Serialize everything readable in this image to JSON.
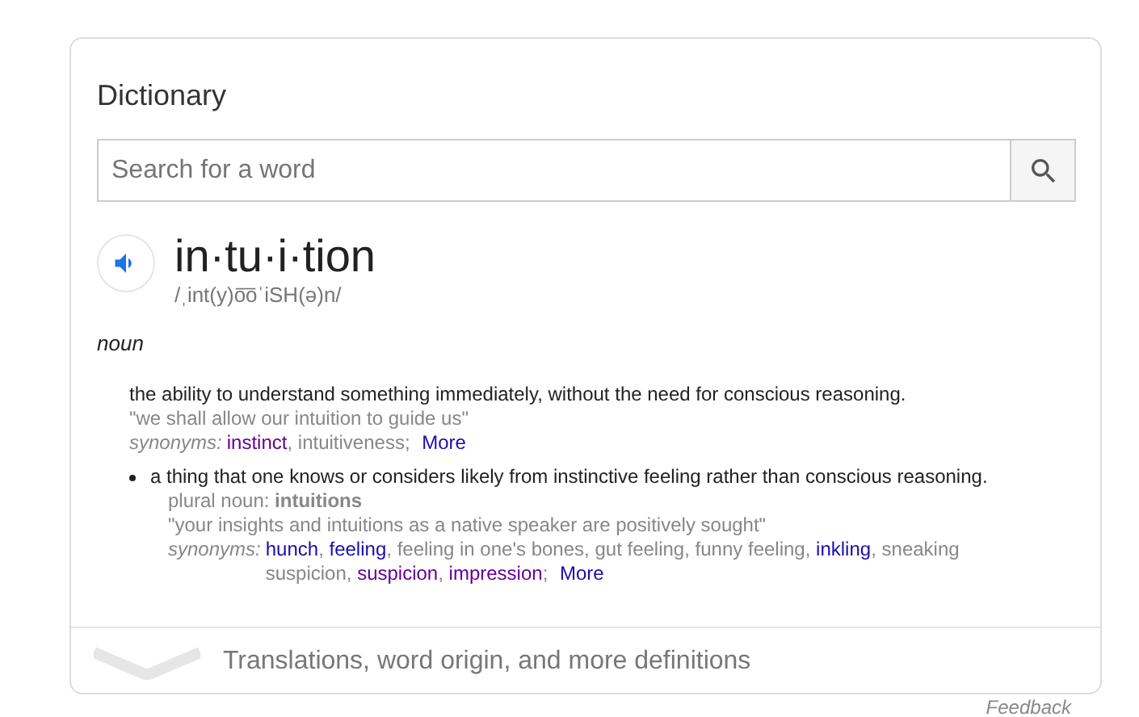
{
  "card": {
    "title": "Dictionary",
    "search": {
      "placeholder": "Search for a word"
    },
    "word": "in·tu·i·tion",
    "pronunciation": "/ˌint(y)o͞oˈiSH(ə)n/",
    "part_of_speech": "noun",
    "senses": [
      {
        "bullet": false,
        "definition": "the ability to understand something immediately, without the need for conscious reasoning.",
        "example": "\"we shall allow our intuition to guide us\"",
        "synonyms_label": "synonyms:",
        "synonyms": [
          {
            "text": "instinct",
            "kind": "visited",
            "separator": ","
          },
          {
            "text": "intuitiveness",
            "kind": "plain",
            "separator": ";"
          }
        ],
        "more": "More"
      },
      {
        "bullet": true,
        "definition": "a thing that one knows or considers likely from instinctive feeling rather than conscious reasoning.",
        "plural": "plural noun: **intuitions**",
        "example": "\"your insights and intuitions as a native speaker are positively sought\"",
        "synonyms_label": "synonyms:",
        "synonyms": [
          {
            "text": "hunch",
            "kind": "link",
            "separator": ","
          },
          {
            "text": "feeling",
            "kind": "link",
            "separator": ","
          },
          {
            "text": "feeling in one's bones",
            "kind": "plain",
            "separator": ","
          },
          {
            "text": "gut feeling",
            "kind": "plain",
            "separator": ","
          },
          {
            "text": "funny feeling",
            "kind": "plain",
            "separator": ","
          },
          {
            "text": "inkling",
            "kind": "link",
            "separator": ","
          },
          {
            "text": "sneaking",
            "kind": "plain"
          },
          {
            "text": "suspicion",
            "kind": "plain",
            "separator": ","
          },
          {
            "text": "suspicion",
            "kind": "visited",
            "separator": ","
          },
          {
            "text": "impression",
            "kind": "visited",
            "separator": ";"
          }
        ],
        "more": "More"
      }
    ],
    "footer": "Translations, word origin, and more definitions"
  },
  "feedback": "Feedback"
}
